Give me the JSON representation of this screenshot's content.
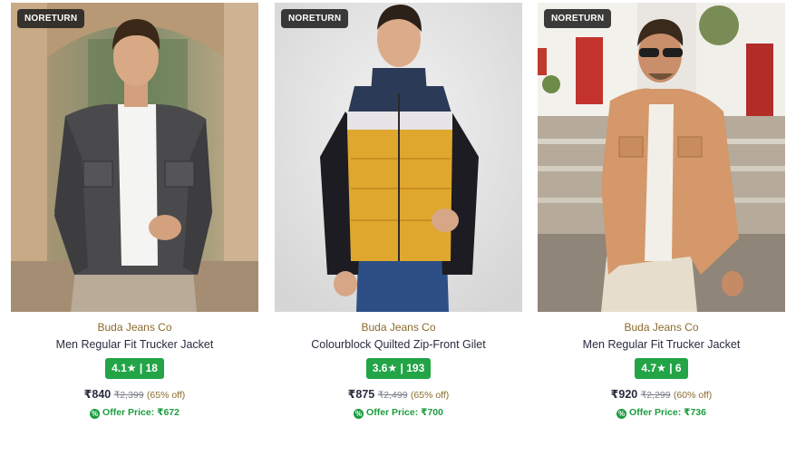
{
  "products": [
    {
      "badge": "NORETURN",
      "brand": "Buda Jeans Co",
      "name": "Men Regular Fit Trucker Jacket",
      "rating": "4.1★ | 18",
      "price": "₹840",
      "mrp": "₹2,399",
      "discount": "(65% off)",
      "offer": "Offer Price: ₹672",
      "offer_icon": "%",
      "image": "Man in charcoal acid-wash denim trucker jacket, white tee, beige trousers, arched courtyard background"
    },
    {
      "badge": "NORETURN",
      "brand": "Buda Jeans Co",
      "name": "Colourblock Quilted Zip-Front Gilet",
      "rating": "3.6★ | 193",
      "price": "₹875",
      "mrp": "₹2,499",
      "discount": "(65% off)",
      "offer": "Offer Price: ₹700",
      "offer_icon": "%",
      "image": "Man in navy, white and mustard colourblock quilted gilet over black sweater with blue jeans, grey studio background"
    },
    {
      "badge": "NORETURN",
      "brand": "Buda Jeans Co",
      "name": "Men Regular Fit Trucker Jacket",
      "rating": "4.7★ | 6",
      "price": "₹920",
      "mrp": "₹2,299",
      "discount": "(60% off)",
      "offer": "Offer Price: ₹736",
      "offer_icon": "%",
      "image": "Smiling man with sunglasses in tan trucker jacket, white tee, cream trousers, white-washed street with red doors"
    }
  ],
  "colors": {
    "rating_bg": "#22a447",
    "brand": "#8a6b2e",
    "offer": "#1a9c3e",
    "badge_bg": "#212121"
  }
}
